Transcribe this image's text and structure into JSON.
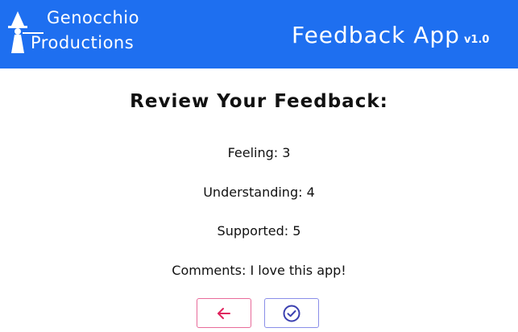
{
  "header": {
    "company_line1": "Genocchio",
    "company_line2": "Productions",
    "app_name": "Feedback App",
    "app_version": "v1.0",
    "background_color": "#1e6ff0",
    "logo_icon": "witch-hat-figure-icon"
  },
  "review": {
    "title": "Review Your Feedback:",
    "rows": [
      {
        "label": "Feeling",
        "value": "3",
        "text": "Feeling: 3"
      },
      {
        "label": "Understanding",
        "value": "4",
        "text": "Understanding: 4"
      },
      {
        "label": "Supported",
        "value": "5",
        "text": "Supported: 5"
      },
      {
        "label": "Comments",
        "value": "I love this app!",
        "text": "Comments: I love this app!"
      }
    ]
  },
  "actions": {
    "back": {
      "icon": "arrow-left-icon",
      "color": "#e0245e"
    },
    "submit": {
      "icon": "check-circle-icon",
      "color": "#3a3fb0"
    }
  }
}
